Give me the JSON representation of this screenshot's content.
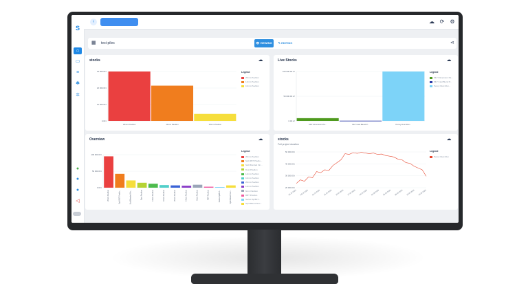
{
  "topbar": {
    "back_icon": "chevron-left-icon",
    "icons": [
      "cloud-icon",
      "refresh-icon",
      "gear-icon"
    ]
  },
  "titlebar": {
    "title": "test piles",
    "viewing_label": "VIEWING",
    "editing_label": "EDITING"
  },
  "sidebar": {
    "icons": [
      "logo-icon",
      "home-icon",
      "folder-icon",
      "chart-icon",
      "star-icon",
      "gear-icon",
      "status-icon",
      "info-icon",
      "user-icon",
      "logout-icon",
      "toggle-icon"
    ]
  },
  "panels": {
    "stocks1": {
      "title": "stocks",
      "legend_title": "Legend"
    },
    "live": {
      "title": "Live Stocks",
      "legend_title": "Legend"
    },
    "overview": {
      "title": "Overview",
      "legend_title": "Legend"
    },
    "stocks2": {
      "title": "stocks",
      "subtitle": "Full project duration",
      "legend_title": "Legend"
    }
  },
  "chart_data": [
    {
      "type": "bar",
      "title": "stocks",
      "categories": [
        "20mm Pavilion",
        "14mm Pavilion",
        "10mm Pavilion"
      ],
      "values": [
        35000,
        25000,
        5000
      ],
      "ylim": [
        0,
        35000
      ],
      "yticks": [
        "0.00 t",
        "10 000.00 t",
        "20 000.00 t",
        "30 000.00 t"
      ],
      "colors": [
        "#ea4040",
        "#f07d1e",
        "#f6de3c"
      ]
    },
    {
      "type": "bar",
      "title": "Live Stocks",
      "categories": [
        "MLT Dimension Pa...",
        "MLT Cast Blend P...",
        "Penny Dust Run..."
      ],
      "values": [
        4000,
        300,
        70000
      ],
      "ylim": [
        0,
        70000
      ],
      "yticks": [
        "0.00 m³",
        "50 000.00 m³",
        "100 000.00 m³"
      ],
      "colors": [
        "#4f9a1e",
        "#2b3aa8",
        "#7dd3f8"
      ]
    },
    {
      "type": "bar",
      "title": "Overview",
      "categories": [
        "20mm Pavilion",
        "Sub RBT Pavilio...",
        "Sub Blended Fin...",
        "Dust Pavilion",
        "14mm Pavilion",
        "10mm Pavilion",
        "20mm Pavilion",
        "14mm Pavilion",
        "6mm Pavilion",
        "RBT Pavilion",
        "Series Sp/BLT...",
        "Sp/3 Blend Stoc..."
      ],
      "values": [
        95000,
        42000,
        22000,
        15000,
        12000,
        8000,
        7000,
        6000,
        9000,
        3000,
        2000,
        7000
      ],
      "ylim": [
        0,
        100000
      ],
      "yticks": [
        "0.00 t",
        "50 000.00 t",
        "100 000.00 t"
      ],
      "colors": [
        "#ea4040",
        "#f07d1e",
        "#f6de3c",
        "#b5d334",
        "#4dbb4d",
        "#52cfc9",
        "#3a63d6",
        "#8a3cc8",
        "#9aa5b8",
        "#f05aa0",
        "#7dd3f8",
        "#f6de3c"
      ]
    },
    {
      "type": "line",
      "title": "stocks",
      "subtitle": "Full project duration",
      "series": [
        {
          "name": "Penny Dust Run",
          "color": "#e8472f"
        }
      ],
      "x": [
        "25.12.2024",
        "29.12.2024",
        "31.12.2024",
        "01.01.2025",
        "10.01.2025",
        "17.01.2025",
        "24.01.2025",
        "01.02.2025",
        "05.02.2025",
        "08.02.2025",
        "10.02.2025",
        "15.02.2025"
      ],
      "yticks": [
        "20 000.00 t",
        "30 000.00 t",
        "40 000.00 t",
        "50 000.00 t"
      ],
      "ylim": [
        20000,
        55000
      ]
    }
  ]
}
